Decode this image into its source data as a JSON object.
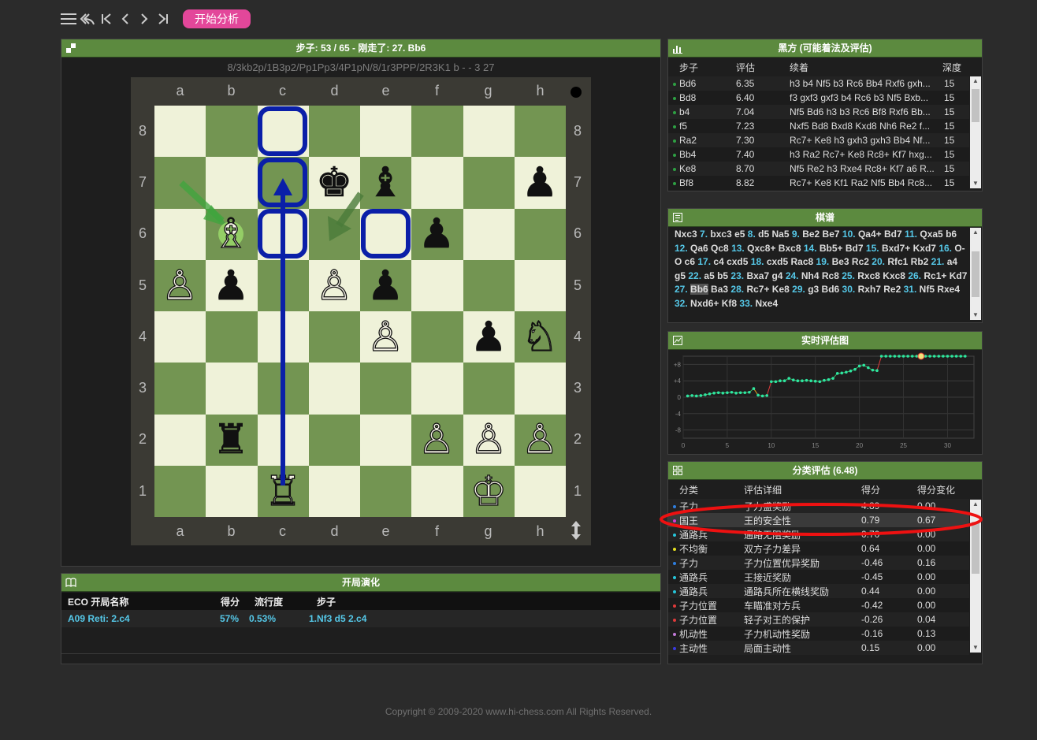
{
  "toolbar": {
    "start_label": "开始分析",
    "icons": [
      "menu-icon",
      "undo-icon",
      "first-icon",
      "prev-icon",
      "next-icon",
      "last-icon"
    ]
  },
  "board_panel": {
    "title": "步子: 53 / 65 - 刚走了: 27. Bb6",
    "fen": "8/3kb2p/1B3p2/Pp1Pp3/4P1pN/8/1r3PPP/2R3K1 b - - 3 27",
    "files": [
      "a",
      "b",
      "c",
      "d",
      "e",
      "f",
      "g",
      "h"
    ],
    "ranks": [
      "8",
      "7",
      "6",
      "5",
      "4",
      "3",
      "2",
      "1"
    ]
  },
  "best_moves": {
    "title": "黑方 (可能着法及评估)",
    "headers": [
      "步子",
      "评估",
      "续着",
      "深度"
    ],
    "rows": [
      {
        "move": "Bd6",
        "eval": "6.35",
        "line": "h3 b4 Nf5 b3 Rc6 Bb4 Rxf6 gxh...",
        "depth": "15"
      },
      {
        "move": "Bd8",
        "eval": "6.40",
        "line": "f3 gxf3 gxf3 b4 Rc6 b3 Nf5 Bxb...",
        "depth": "15"
      },
      {
        "move": "b4",
        "eval": "7.04",
        "line": "Nf5 Bd6 h3 b3 Rc6 Bf8 Rxf6 Bb...",
        "depth": "15"
      },
      {
        "move": "f5",
        "eval": "7.23",
        "line": "Nxf5 Bd8 Bxd8 Kxd8 Nh6 Re2 f...",
        "depth": "15"
      },
      {
        "move": "Ra2",
        "eval": "7.30",
        "line": "Rc7+ Ke8 h3 gxh3 gxh3 Bb4 Nf...",
        "depth": "15"
      },
      {
        "move": "Bb4",
        "eval": "7.40",
        "line": "h3 Ra2 Rc7+ Ke8 Rc8+ Kf7 hxg...",
        "depth": "15"
      },
      {
        "move": "Ke8",
        "eval": "8.70",
        "line": "Nf5 Re2 h3 Rxe4 Rc8+ Kf7 a6 R...",
        "depth": "15"
      },
      {
        "move": "Bf8",
        "eval": "8.82",
        "line": "Rc7+ Ke8 Kf1 Ra2 Nf5 Bb4 Rc8...",
        "depth": "15"
      }
    ]
  },
  "game_record": {
    "title": "棋谱",
    "moves": [
      {
        "n": "",
        "m": "Nxc3"
      },
      {
        "n": "7.",
        "m": "bxc3 e5"
      },
      {
        "n": "8.",
        "m": "d5 Na5"
      },
      {
        "n": "9.",
        "m": "Be2 Be7"
      },
      {
        "n": "10.",
        "m": "Qa4+ Bd7"
      },
      {
        "n": "11.",
        "m": "Qxa5 b6"
      },
      {
        "n": "12.",
        "m": "Qa6 Qc8"
      },
      {
        "n": "13.",
        "m": "Qxc8+ Bxc8"
      },
      {
        "n": "14.",
        "m": "Bb5+ Bd7"
      },
      {
        "n": "15.",
        "m": "Bxd7+ Kxd7"
      },
      {
        "n": "16.",
        "m": "O-O c6"
      },
      {
        "n": "17.",
        "m": "c4 cxd5"
      },
      {
        "n": "18.",
        "m": "cxd5 Rac8"
      },
      {
        "n": "19.",
        "m": "Be3 Rc2"
      },
      {
        "n": "20.",
        "m": "Rfc1 Rb2"
      },
      {
        "n": "21.",
        "m": "a4 g5"
      },
      {
        "n": "22.",
        "m": "a5 b5"
      },
      {
        "n": "23.",
        "m": "Bxa7 g4"
      },
      {
        "n": "24.",
        "m": "Nh4 Rc8"
      },
      {
        "n": "25.",
        "m": "Rxc8 Kxc8"
      },
      {
        "n": "26.",
        "m": "Rc1+ Kd7"
      },
      {
        "n": "27.",
        "m": "Bb6",
        "current": true
      },
      {
        "n": "",
        "m": "Ba3"
      },
      {
        "n": "28.",
        "m": "Rc7+ Ke8"
      },
      {
        "n": "29.",
        "m": "g3 Bd6"
      },
      {
        "n": "30.",
        "m": "Rxh7 Re2"
      },
      {
        "n": "31.",
        "m": "Nf5 Rxe4"
      },
      {
        "n": "32.",
        "m": "Nxd6+ Kf8"
      },
      {
        "n": "33.",
        "m": "Nxe4"
      }
    ]
  },
  "eval_chart": {
    "title": "实时评估图",
    "chart_data": {
      "type": "line",
      "title": "",
      "xlim": [
        0,
        33
      ],
      "ylim": [
        -10,
        10
      ],
      "xticks": [
        0,
        5,
        10,
        15,
        20,
        25,
        30
      ],
      "yticks": [
        "+8",
        "+4",
        "0",
        "-4",
        "-8"
      ],
      "current_index": 27,
      "series": [
        {
          "values": [
            0.3,
            0.4,
            0.3,
            0.4,
            0.6,
            0.8,
            1.0,
            1.1,
            1.0,
            1.1,
            1.2,
            1.0,
            1.1,
            1.1,
            1.2,
            2.1,
            0.5,
            0.3,
            0.4,
            3.8,
            3.8,
            4.0,
            4.0,
            4.6,
            4.2,
            4.0,
            4.0,
            4.1,
            4.0,
            3.9,
            3.8,
            4.1,
            4.3,
            4.6,
            5.8,
            5.9,
            6.1,
            6.4,
            6.8,
            7.6,
            7.8,
            7.2,
            6.6,
            6.5,
            10.0,
            10.0,
            10.0,
            10.0,
            10.0,
            10.0,
            10.0,
            10.0,
            10.0,
            10.0,
            10.0,
            10.0,
            10.0,
            10.0,
            10.0,
            10.0,
            10.0,
            10.0,
            10.0,
            10.0
          ]
        }
      ]
    }
  },
  "category_eval": {
    "title": "分类评估 (6.48)",
    "headers": [
      "分类",
      "评估详细",
      "得分",
      "得分变化"
    ],
    "rows": [
      {
        "cat": "子力",
        "detail": "子力盛奖励",
        "score": "4.89",
        "delta": "0.00",
        "color": "#2e7fe0"
      },
      {
        "cat": "国王",
        "detail": "王的安全性",
        "score": "0.79",
        "delta": "0.67",
        "color": "#d53bd5"
      },
      {
        "cat": "通路兵",
        "detail": "通路无阻奖励",
        "score": "0.70",
        "delta": "0.00",
        "color": "#26c6da"
      },
      {
        "cat": "不均衡",
        "detail": "双方子力差异",
        "score": "0.64",
        "delta": "0.00",
        "color": "#e6e020"
      },
      {
        "cat": "子力",
        "detail": "子力位置优异奖励",
        "score": "-0.46",
        "delta": "0.16",
        "color": "#2e7fe0"
      },
      {
        "cat": "通路兵",
        "detail": "王接近奖励",
        "score": "-0.45",
        "delta": "0.00",
        "color": "#26c6da"
      },
      {
        "cat": "通路兵",
        "detail": "通路兵所在横线奖励",
        "score": "0.44",
        "delta": "0.00",
        "color": "#26c6da"
      },
      {
        "cat": "子力位置",
        "detail": "车瞄准对方兵",
        "score": "-0.42",
        "delta": "0.00",
        "color": "#e03a3a"
      },
      {
        "cat": "子力位置",
        "detail": "轻子对王的保护",
        "score": "-0.26",
        "delta": "0.04",
        "color": "#e03a3a"
      },
      {
        "cat": "机动性",
        "detail": "子力机动性奖励",
        "score": "-0.16",
        "delta": "0.13",
        "color": "#c27ad8"
      },
      {
        "cat": "主动性",
        "detail": "局面主动性",
        "score": "0.15",
        "delta": "0.00",
        "color": "#3a3ae0"
      }
    ]
  },
  "opening": {
    "title": "开局演化",
    "headers": {
      "eco": "ECO 开局名称",
      "score": "得分",
      "pop": "流行度",
      "moves": "步子"
    },
    "row": {
      "eco": "A09 Reti: 2.c4",
      "score": "57%",
      "pop": "0.53%",
      "moves": "1.Nf3 d5 2.c4"
    }
  },
  "footer": "Copyright © 2009-2020 www.hi-chess.com All Rights Reserved.",
  "colors": {
    "header_green": "#5c8a3f",
    "board_light": "#eff2d9",
    "board_dark": "#739552",
    "accent_pink": "#e3479a",
    "link_blue": "#55c8e8",
    "arrow_blue": "#0a1fa8",
    "annotation_red": "#ee1111"
  }
}
